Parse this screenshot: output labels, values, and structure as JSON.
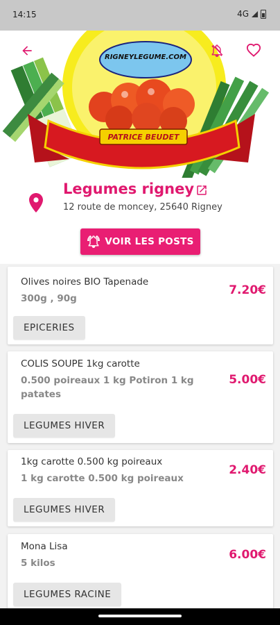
{
  "status_bar": {
    "time": "14:15",
    "network": "4G"
  },
  "hero": {
    "logo_url_text": "RIGNEYLEGUME.COM",
    "banner_text": "PATRICE BEUDET"
  },
  "icons": {
    "back": "arrow-left-icon",
    "notifications_off": "bell-off-icon",
    "favorite": "heart-outline-icon",
    "location": "location-pin-icon",
    "external_link": "open-in-new-icon",
    "posts": "bell-ring-icon"
  },
  "shop": {
    "name": "Legumes rigney",
    "address": "12 route de moncey, 25640 Rigney",
    "posts_button_label": "VOIR LES POSTS"
  },
  "colors": {
    "accent": "#e0196f",
    "button": "#e91e73"
  },
  "products": [
    {
      "title": "Olives noires BIO Tapenade",
      "description": "300g , 90g",
      "price": "7.20€",
      "category": "EPICERIES"
    },
    {
      "title": "COLIS SOUPE 1kg carotte",
      "description": "0.500 poireaux 1 kg Potiron 1 kg patates",
      "price": "5.00€",
      "category": "LEGUMES HIVER"
    },
    {
      "title": "1kg carotte 0.500 kg poireaux",
      "description": "1 kg carotte 0.500 kg poireaux",
      "price": "2.40€",
      "category": "LEGUMES HIVER"
    },
    {
      "title": "Mona Lisa",
      "description": "5 kilos",
      "price": "6.00€",
      "category": "LEGUMES RACINE"
    }
  ]
}
